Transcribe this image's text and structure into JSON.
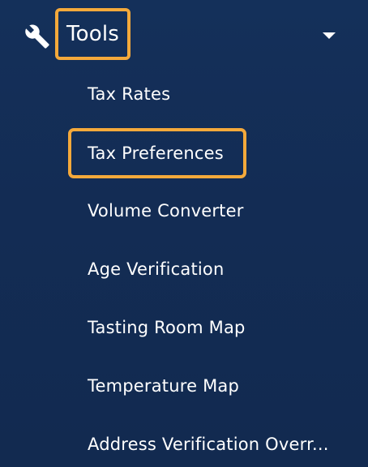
{
  "nav": {
    "group": {
      "icon": "wrench-icon",
      "label": "Tools",
      "expanded_icon": "chevron-down-icon"
    },
    "items": [
      {
        "label": "Tax Rates"
      },
      {
        "label": "Tax Preferences",
        "highlighted": true
      },
      {
        "label": "Volume Converter"
      },
      {
        "label": "Age Verification"
      },
      {
        "label": "Tasting Room Map"
      },
      {
        "label": "Temperature Map"
      },
      {
        "label": "Address Verification Overr..."
      }
    ]
  },
  "colors": {
    "background": "#14305a",
    "highlight_border": "#f4a93b",
    "text": "#ffffff"
  }
}
